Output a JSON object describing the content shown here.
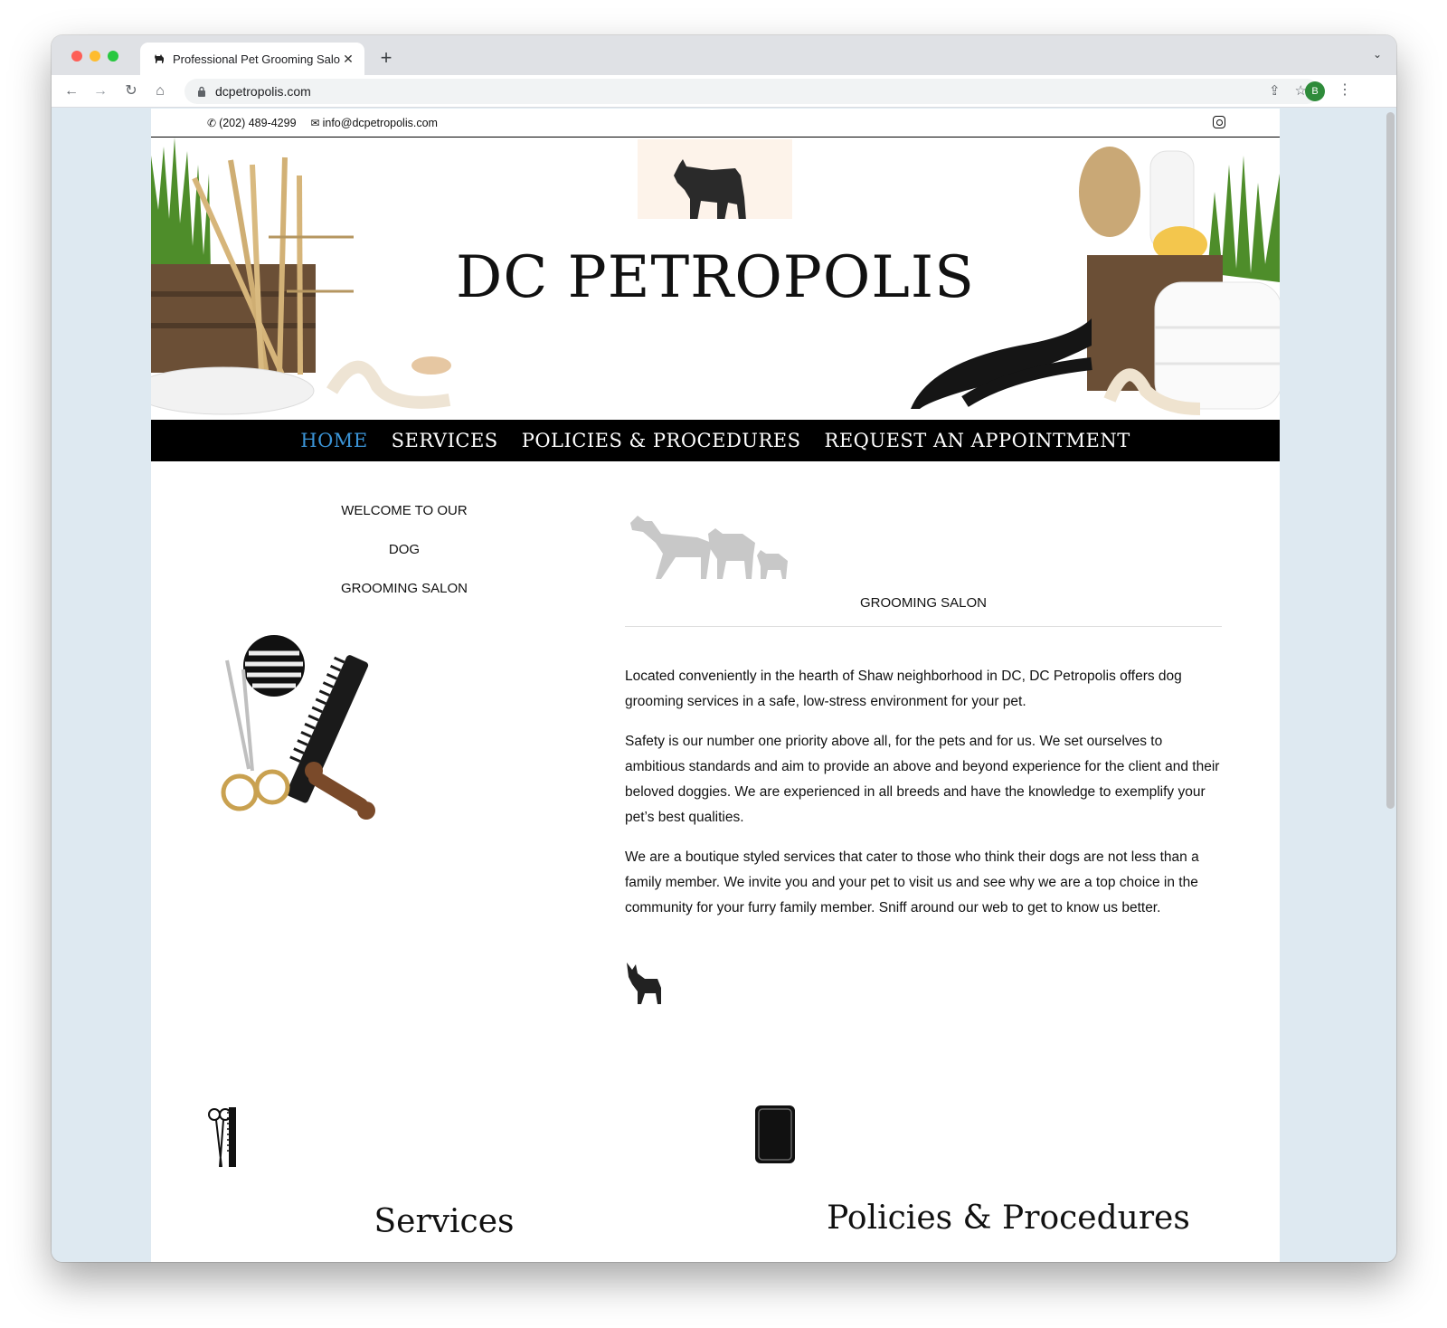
{
  "browser": {
    "tab_title": "Professional Pet Grooming Salo",
    "url": "dcpetropolis.com",
    "profile_initial": "B"
  },
  "topbar": {
    "phone": "(202) 489-4299",
    "email": "info@dcpetropolis.com"
  },
  "hero": {
    "brand": "DC PETROPOLIS"
  },
  "nav": {
    "items": [
      "HOME",
      "SERVICES",
      "POLICIES & PROCEDURES",
      "REQUEST AN APPOINTMENT"
    ],
    "active": "HOME",
    "active_color": "#3b95d8"
  },
  "welcome": {
    "line1": "WELCOME TO OUR",
    "line2": "DOG",
    "line3": "GROOMING SALON"
  },
  "intro": {
    "label": "GROOMING SALON",
    "p1": "Located conveniently in the hearth of Shaw neighborhood in DC, DC Petropolis offers dog grooming services in a safe, low-stress environment for your pet.",
    "p2": "Safety is our number one priority above all, for the pets and for us. We set ourselves to ambitious standards and aim to provide an above and beyond experience for the client and their beloved doggies. We are experienced in all breeds and have the knowledge to exemplify your pet’s best qualities.",
    "p3": "We are a boutique styled services that cater to those who think their dogs are not less than a family member. We invite you and your pet to visit us and see why we are a top choice in the community for your furry family member. Sniff around our web to get to know us better."
  },
  "sections": {
    "services_title": "Services",
    "policies_title": "Policies & Procedures"
  }
}
